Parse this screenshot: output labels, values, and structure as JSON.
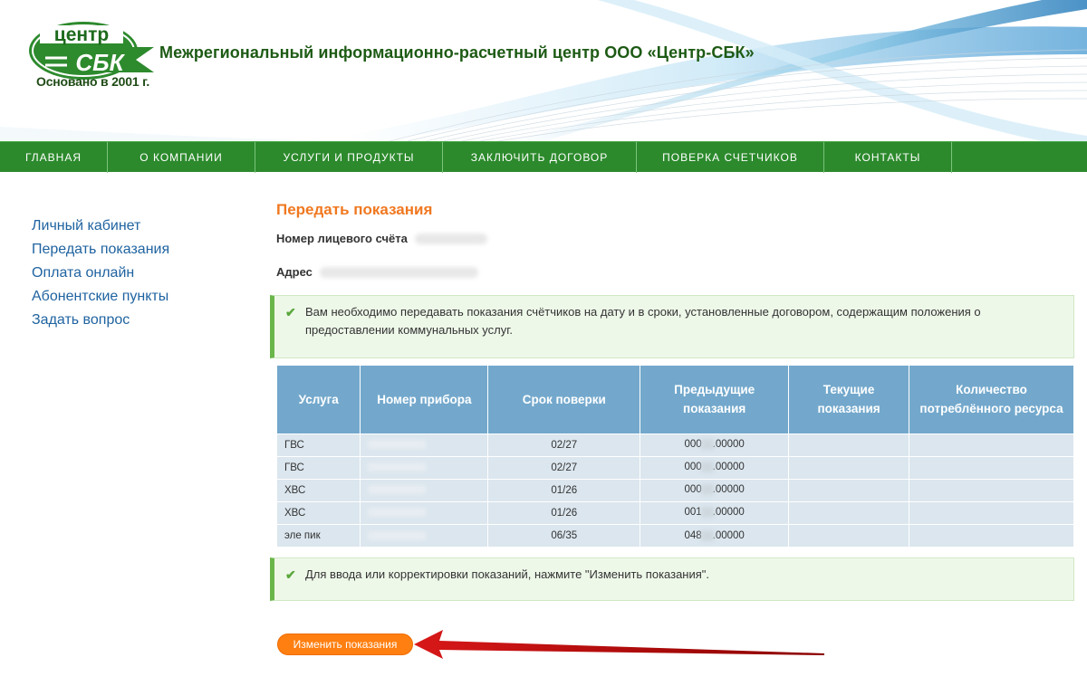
{
  "header": {
    "logo_text": "центр СБК",
    "logo_tagline": "Основано в 2001 г.",
    "site_title": "Межрегиональный информационно-расчетный центр ООО «Центр-СБК»"
  },
  "nav": {
    "items": [
      {
        "label": "ГЛАВНАЯ"
      },
      {
        "label": "О КОМПАНИИ"
      },
      {
        "label": "УСЛУГИ И ПРОДУКТЫ"
      },
      {
        "label": "ЗАКЛЮЧИТЬ ДОГОВОР"
      },
      {
        "label": "ПОВЕРКА СЧЕТЧИКОВ"
      },
      {
        "label": "КОНТАКТЫ"
      }
    ]
  },
  "sidebar": {
    "items": [
      {
        "label": "Личный кабинет"
      },
      {
        "label": "Передать показания"
      },
      {
        "label": "Оплата онлайн"
      },
      {
        "label": "Абонентские пункты"
      },
      {
        "label": "Задать вопрос"
      }
    ]
  },
  "main": {
    "title": "Передать показания",
    "account_label": "Номер лицевого счёта",
    "address_label": "Адрес",
    "alert_top": "Вам необходимо передавать показания счётчиков на дату и в сроки, установленные договором, содержащим положения о предоставлении коммунальных услуг.",
    "alert_bottom": "Для ввода или корректировки показаний, нажмите \"Изменить показания\".",
    "button_label": "Изменить показания"
  },
  "table": {
    "headers": [
      "Услуга",
      "Номер прибора",
      "Срок поверки",
      "Предыдущие показания",
      "Текущие показания",
      "Количество потреблённого ресурса"
    ],
    "rows": [
      {
        "service": "ГВС",
        "due": "02/27",
        "prev_a": "000",
        "prev_b": ".00000"
      },
      {
        "service": "ГВС",
        "due": "02/27",
        "prev_a": "000",
        "prev_b": ".00000"
      },
      {
        "service": "ХВС",
        "due": "01/26",
        "prev_a": "000",
        "prev_b": ".00000"
      },
      {
        "service": "ХВС",
        "due": "01/26",
        "prev_a": "001",
        "prev_b": ".00000"
      },
      {
        "service": "эле пик",
        "due": "06/35",
        "prev_a": "048",
        "prev_b": ".00000"
      }
    ]
  },
  "colors": {
    "nav_green": "#2c8a2c",
    "title_orange": "#f07820",
    "link_blue": "#1f63a0",
    "table_header": "#73a8cc",
    "button_orange": "#ff7f10",
    "arrow_red": "#c00000"
  }
}
